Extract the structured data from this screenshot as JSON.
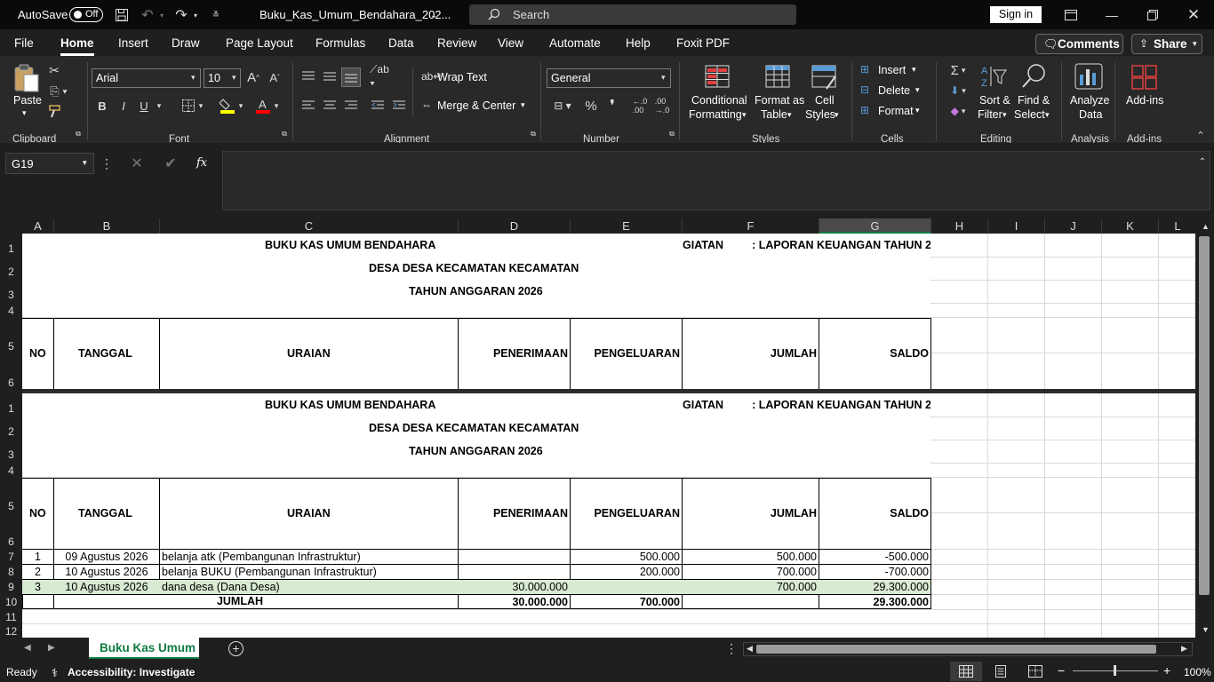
{
  "titlebar": {
    "autosave_label": "AutoSave",
    "autosave_state": "Off",
    "filename": "Buku_Kas_Umum_Bendahara_202...",
    "search_placeholder": "Search",
    "signin_label": "Sign in"
  },
  "menu": [
    "File",
    "Home",
    "Insert",
    "Draw",
    "Page Layout",
    "Formulas",
    "Data",
    "Review",
    "View",
    "Automate",
    "Help",
    "Foxit PDF"
  ],
  "menu_active": "Home",
  "comments_label": "Comments",
  "share_label": "Share",
  "ribbon": {
    "paste": "Paste",
    "font_name": "Arial",
    "font_size": "10",
    "wrap_text": "Wrap Text",
    "merge_center": "Merge & Center",
    "number_format": "General",
    "conditional_1": "Conditional",
    "conditional_2": "Formatting",
    "format_table_1": "Format as",
    "format_table_2": "Table",
    "cell_styles_1": "Cell",
    "cell_styles_2": "Styles",
    "insert": "Insert",
    "delete": "Delete",
    "format": "Format",
    "sort_1": "Sort &",
    "sort_2": "Filter",
    "find_1": "Find &",
    "find_2": "Select",
    "analyze_1": "Analyze",
    "analyze_2": "Data",
    "addins": "Add-ins",
    "groups": {
      "clipboard": "Clipboard",
      "font": "Font",
      "alignment": "Alignment",
      "number": "Number",
      "styles": "Styles",
      "cells": "Cells",
      "editing": "Editing",
      "analysis": "Analysis",
      "addins": "Add-ins"
    }
  },
  "namebox": "G19",
  "fx": "fx",
  "columns": [
    "A",
    "B",
    "C",
    "D",
    "E",
    "F",
    "G",
    "H",
    "I",
    "J",
    "K",
    "L"
  ],
  "sheet": {
    "title1": "BUKU KAS UMUM BENDAHARA",
    "title2": "DESA DESA KECAMATAN KECAMATAN",
    "title3": "TAHUN ANGGARAN 2026",
    "kegiatan": "GIATAN",
    "laporan": ": LAPORAN KEUANGAN TAHUN 2",
    "headers": {
      "no": "NO",
      "tanggal": "TANGGAL",
      "uraian": "URAIAN",
      "penerimaan": "PENERIMAAN",
      "pengeluaran": "PENGELUARAN",
      "jumlah": "JUMLAH",
      "saldo": "SALDO"
    },
    "rows": [
      {
        "no": "1",
        "tanggal": "09 Agustus 2026",
        "uraian": "belanja atk (Pembangunan Infrastruktur)",
        "penerimaan": "",
        "pengeluaran": "500.000",
        "jumlah": "500.000",
        "saldo": "-500.000"
      },
      {
        "no": "2",
        "tanggal": "10 Agustus 2026",
        "uraian": "belanja BUKU (Pembangunan Infrastruktur)",
        "penerimaan": "",
        "pengeluaran": "200.000",
        "jumlah": "700.000",
        "saldo": "-700.000"
      },
      {
        "no": "3",
        "tanggal": "10 Agustus 2026",
        "uraian": "dana desa (Dana Desa)",
        "penerimaan": "30.000.000",
        "pengeluaran": "",
        "jumlah": "700.000",
        "saldo": "29.300.000"
      }
    ],
    "total": {
      "label": "JUMLAH",
      "penerimaan": "30.000.000",
      "pengeluaran": "700.000",
      "saldo": "29.300.000"
    }
  },
  "row_numbers_top": [
    "1",
    "2",
    "3",
    "4",
    "5",
    "6"
  ],
  "row_numbers_bottom": [
    "1",
    "2",
    "3",
    "4",
    "5",
    "6",
    "7",
    "8",
    "9",
    "10",
    "11",
    "12"
  ],
  "sheet_tab": "Buku Kas Umum",
  "status": {
    "ready": "Ready",
    "accessibility": "Accessibility: Investigate",
    "zoom": "100%"
  },
  "colors": {
    "accent_green": "#107c41",
    "row_highlight": "#d9ead3"
  }
}
